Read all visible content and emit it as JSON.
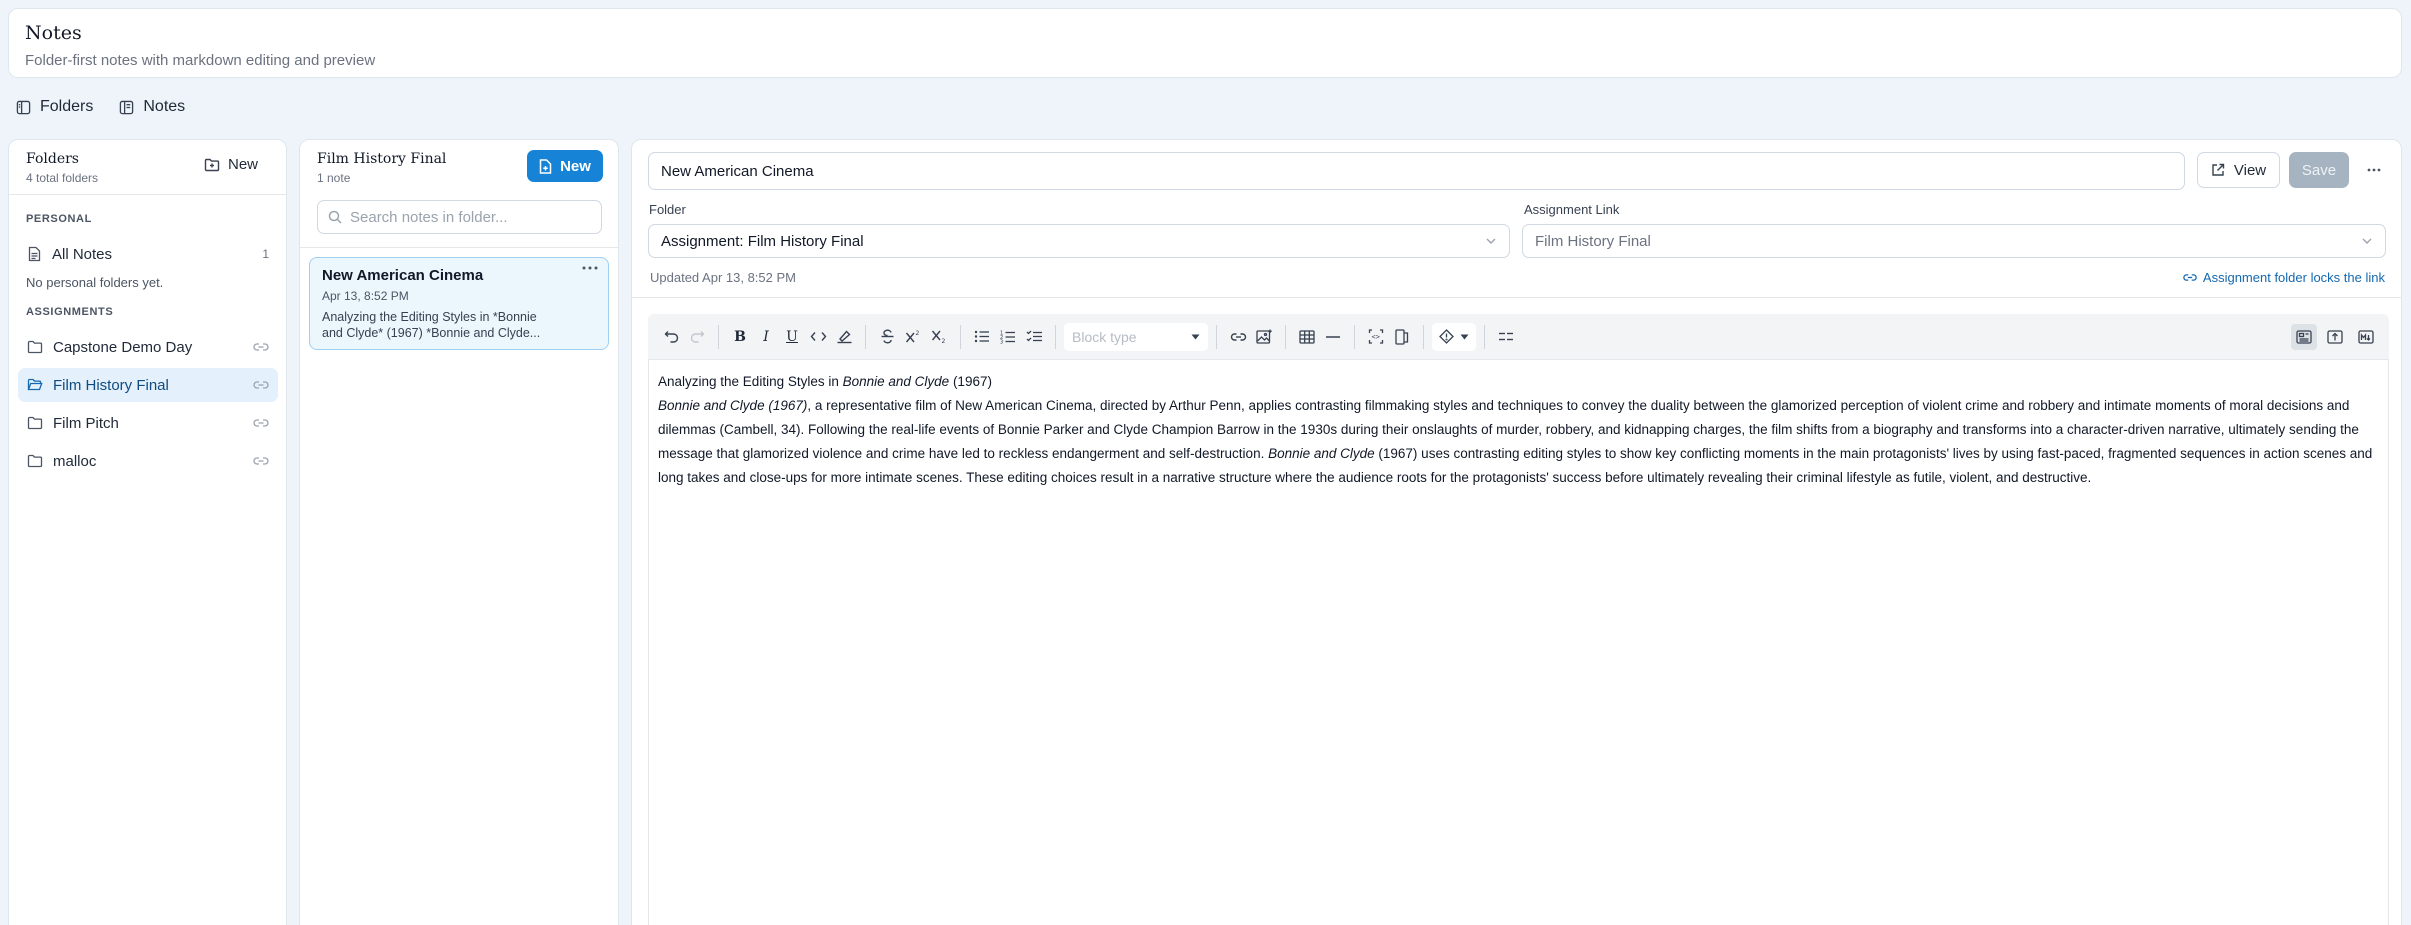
{
  "app": {
    "title": "Notes",
    "subtitle": "Folder-first notes with markdown editing and preview"
  },
  "view_toggle": {
    "folders_label": "Folders",
    "notes_label": "Notes"
  },
  "folders_panel": {
    "title": "Folders",
    "subtitle": "4 total folders",
    "new_label": "New",
    "personal_label": "PERSONAL",
    "all_notes_label": "All Notes",
    "all_notes_count": "1",
    "empty_personal": "No personal folders yet.",
    "assignments_label": "ASSIGNMENTS",
    "assignments": [
      {
        "label": "Capstone Demo Day",
        "active": false
      },
      {
        "label": "Film History Final",
        "active": true
      },
      {
        "label": "Film Pitch",
        "active": false
      },
      {
        "label": "malloc",
        "active": false
      }
    ]
  },
  "notes_panel": {
    "title": "Film History Final",
    "subtitle": "1 note",
    "new_label": "New",
    "search_placeholder": "Search notes in folder...",
    "notes": [
      {
        "title": "New American Cinema",
        "date": "Apr 13, 8:52 PM",
        "snippet": "Analyzing the Editing Styles in *Bonnie and Clyde* (1967) *Bonnie and Clyde..."
      }
    ]
  },
  "editor": {
    "title_value": "New American Cinema",
    "view_label": "View",
    "save_label": "Save",
    "folder_label": "Folder",
    "folder_value": "Assignment: Film History Final",
    "assignment_link_label": "Assignment Link",
    "assignment_link_value": "Film History Final",
    "updated": "Updated Apr 13, 8:52 PM",
    "lock_note": "Assignment folder locks the link",
    "block_type_placeholder": "Block type",
    "content": {
      "heading_pre": "Analyzing the Editing Styles in ",
      "heading_italic": "Bonnie and Clyde",
      "heading_post": " (1967)",
      "para_italic_1": "Bonnie and Clyde (1967)",
      "para_text_1": ", a representative film of New American Cinema, directed by Arthur Penn, applies contrasting filmmaking styles and techniques to convey the duality between the glamorized perception of violent crime and robbery and intimate moments of moral decisions and dilemmas (Cambell, 34). Following the real-life events of Bonnie Parker and Clyde Champion Barrow in the 1930s during their onslaughts of murder, robbery, and kidnapping charges, the film shifts from a biography and transforms into a character-driven narrative, ultimately sending the message that glamorized violence and crime have led to reckless endangerment and self-destruction. ",
      "para_italic_2": "Bonnie and Clyde",
      "para_text_2": " (1967) uses contrasting editing styles to show key conflicting moments in the main protagonists' lives by using fast-paced, fragmented sequences in action scenes and long takes and close-ups for more intimate scenes. These editing choices result in a narrative structure where the audience roots for the protagonists' success before ultimately revealing their criminal lifestyle as futile, violent, and destructive."
    }
  },
  "colors": {
    "accent": "#1683d6",
    "active_folder_bg": "#e4f0fb",
    "note_card_bg": "#ecf6fd",
    "save_disabled": "#a6b3c0",
    "link_blue": "#1668b0"
  },
  "icons": [
    "sidebar-icon",
    "folder-plus-icon",
    "file-plus-icon",
    "search-icon",
    "file-icon",
    "folder-icon",
    "folder-open-icon",
    "link-icon",
    "more-icon",
    "external-link-icon",
    "chevron-down-icon",
    "undo-icon",
    "redo-icon",
    "code-icon",
    "highlight-icon",
    "strikethrough-icon",
    "superscript-icon",
    "subscript-icon",
    "bulleted-list-icon",
    "numbered-list-icon",
    "checklist-icon",
    "image-icon",
    "table-icon",
    "horizontal-rule-icon",
    "diff-icon",
    "fullscreen-icon",
    "admonition-icon",
    "split-view-icon",
    "rich-text-icon",
    "source-mode-icon",
    "markdown-icon"
  ]
}
